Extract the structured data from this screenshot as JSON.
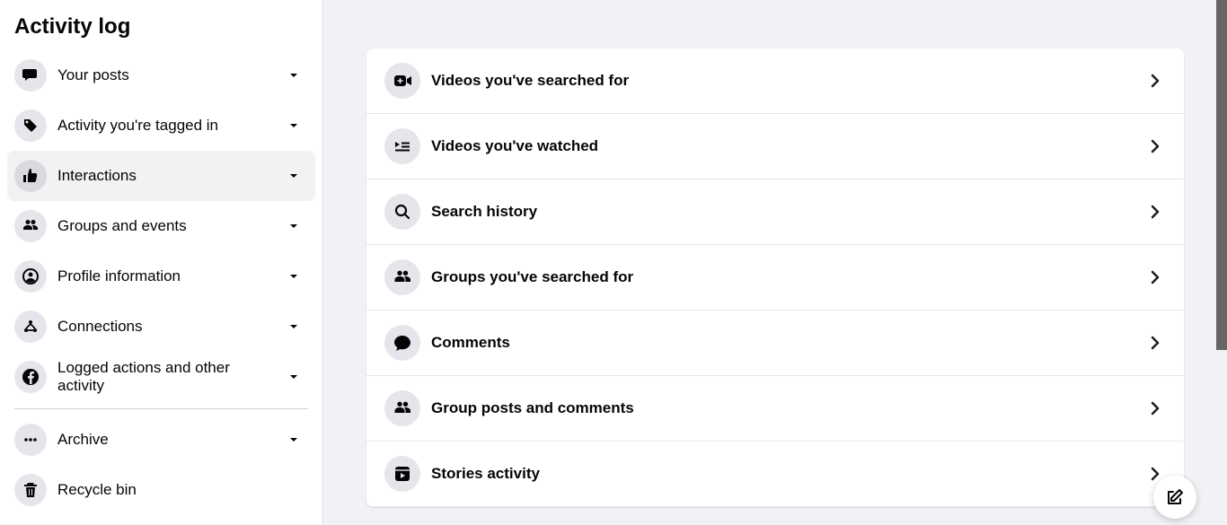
{
  "sidebar": {
    "title": "Activity log",
    "items": [
      {
        "label": "Your posts",
        "icon": "speech-icon",
        "selected": false,
        "expandable": true
      },
      {
        "label": "Activity you're tagged in",
        "icon": "tag-icon",
        "selected": false,
        "expandable": true
      },
      {
        "label": "Interactions",
        "icon": "thumb-up-icon",
        "selected": true,
        "expandable": true
      },
      {
        "label": "Groups and events",
        "icon": "groups-icon",
        "selected": false,
        "expandable": true
      },
      {
        "label": "Profile information",
        "icon": "profile-icon",
        "selected": false,
        "expandable": true
      },
      {
        "label": "Connections",
        "icon": "connections-icon",
        "selected": false,
        "expandable": true
      },
      {
        "label": "Logged actions and other activity",
        "icon": "facebook-icon",
        "selected": false,
        "expandable": true
      }
    ],
    "secondary": [
      {
        "label": "Archive",
        "icon": "archive-icon",
        "expandable": true
      },
      {
        "label": "Recycle bin",
        "icon": "trash-icon",
        "expandable": false
      }
    ]
  },
  "main": {
    "rows": [
      {
        "label": "Videos you've searched for",
        "icon": "video-plus-icon"
      },
      {
        "label": "Videos you've watched",
        "icon": "playlist-icon"
      },
      {
        "label": "Search history",
        "icon": "search-icon"
      },
      {
        "label": "Groups you've searched for",
        "icon": "groups-icon"
      },
      {
        "label": "Comments",
        "icon": "comment-icon"
      },
      {
        "label": "Group posts and comments",
        "icon": "groups-icon"
      },
      {
        "label": "Stories activity",
        "icon": "stories-icon"
      }
    ]
  }
}
